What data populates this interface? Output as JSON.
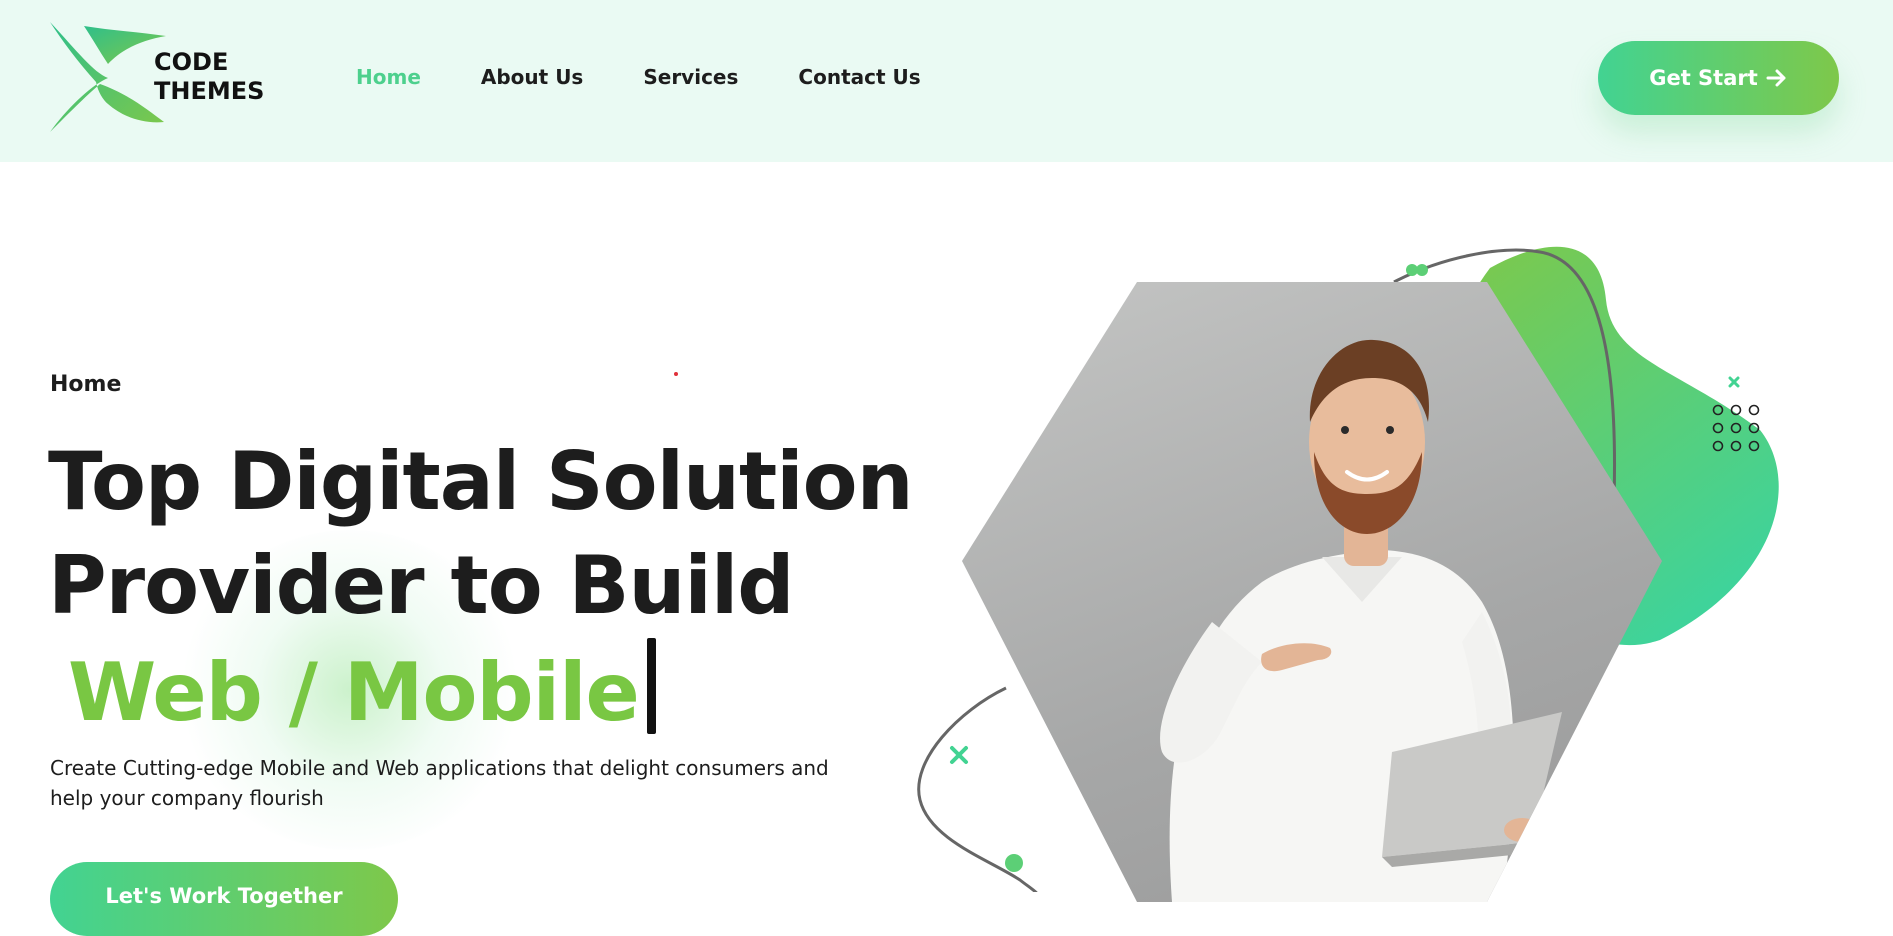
{
  "header": {
    "logo": {
      "line1": "CODE",
      "line2": "THEMES"
    },
    "nav": [
      {
        "label": "Home",
        "active": true
      },
      {
        "label": "About Us",
        "active": false
      },
      {
        "label": "Services",
        "active": false
      },
      {
        "label": "Contact Us",
        "active": false
      }
    ],
    "cta_label": "Get Start",
    "cta_icon": "arrow-right-icon"
  },
  "hero": {
    "breadcrumb": "Home",
    "headline_line1": "Top Digital Solution",
    "headline_line2": "Provider to Build",
    "headline_highlight": "Web / Mobile",
    "description": "Create Cutting-edge Mobile and Web applications that delight consumers and help your company flourish",
    "bottom_button_label": "Let's Work Together"
  },
  "colors": {
    "accent_green": "#79c743",
    "accent_teal": "#42d392",
    "header_bg": "#eafaf3",
    "text": "#1d1d1d"
  }
}
